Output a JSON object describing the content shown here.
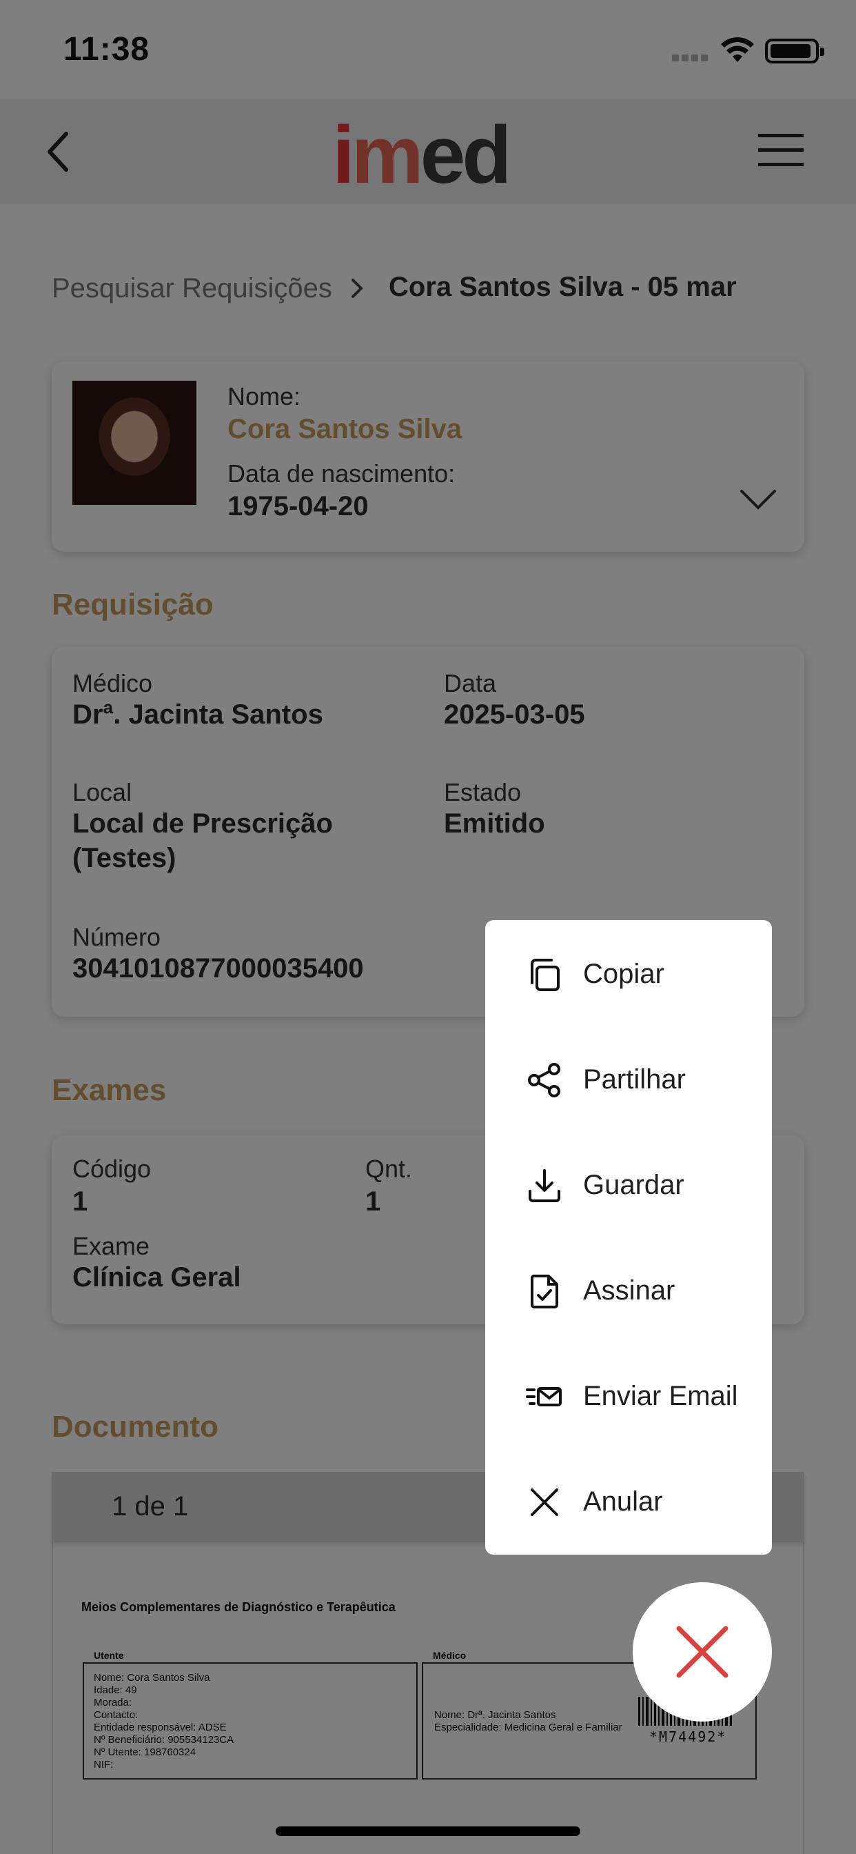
{
  "status_bar": {
    "time": "11:38"
  },
  "header": {
    "logo_i": "i",
    "logo_m": "m",
    "logo_ed": "ed"
  },
  "breadcrumb": {
    "parent": "Pesquisar Requisições",
    "current": "Cora Santos Silva - 05 mar"
  },
  "patient": {
    "name_label": "Nome:",
    "name": "Cora Santos Silva",
    "dob_label": "Data de nascimento:",
    "dob": "1975-04-20"
  },
  "requisition": {
    "title": "Requisição",
    "doctor_label": "Médico",
    "doctor": "Drª. Jacinta Santos",
    "date_label": "Data",
    "date": "2025-03-05",
    "location_label": "Local",
    "location_line1": "Local de Prescrição",
    "location_line2": "(Testes)",
    "state_label": "Estado",
    "state": "Emitido",
    "number_label": "Número",
    "number": "3041010877000035400"
  },
  "exams": {
    "title": "Exames",
    "code_label": "Código",
    "code": "1",
    "qty_label": "Qnt.",
    "qty": "1",
    "exam_label": "Exame",
    "exam": "Clínica Geral"
  },
  "document": {
    "title": "Documento",
    "page_indicator": "1 de 1",
    "heading": "Meios Complementares de Diagnóstico e Terapêutica",
    "utente_label": "Utente",
    "utente_lines": [
      "Nome: Cora Santos Silva",
      "Idade: 49",
      "Morada:",
      "Contacto:",
      "Entidade responsável: ADSE",
      "Nº Beneficiário: 905534123CA",
      "Nº Utente: 198760324",
      "NIF:"
    ],
    "medico_label": "Médico",
    "medico_lines": [
      "Nome: Drª. Jacinta Santos",
      "Especialidade: Medicina Geral e Familiar"
    ],
    "barcode_text": "*M74492*"
  },
  "action_menu": {
    "items": [
      {
        "label": "Copiar",
        "icon": "copy-icon"
      },
      {
        "label": "Partilhar",
        "icon": "share-icon"
      },
      {
        "label": "Guardar",
        "icon": "download-icon"
      },
      {
        "label": "Assinar",
        "icon": "sign-document-icon"
      },
      {
        "label": "Enviar Email",
        "icon": "send-email-icon"
      },
      {
        "label": "Anular",
        "icon": "close-icon"
      }
    ]
  },
  "colors": {
    "accent": "#c79a5e",
    "fab_close": "#d9423f",
    "brand_red": "#e2373a"
  }
}
